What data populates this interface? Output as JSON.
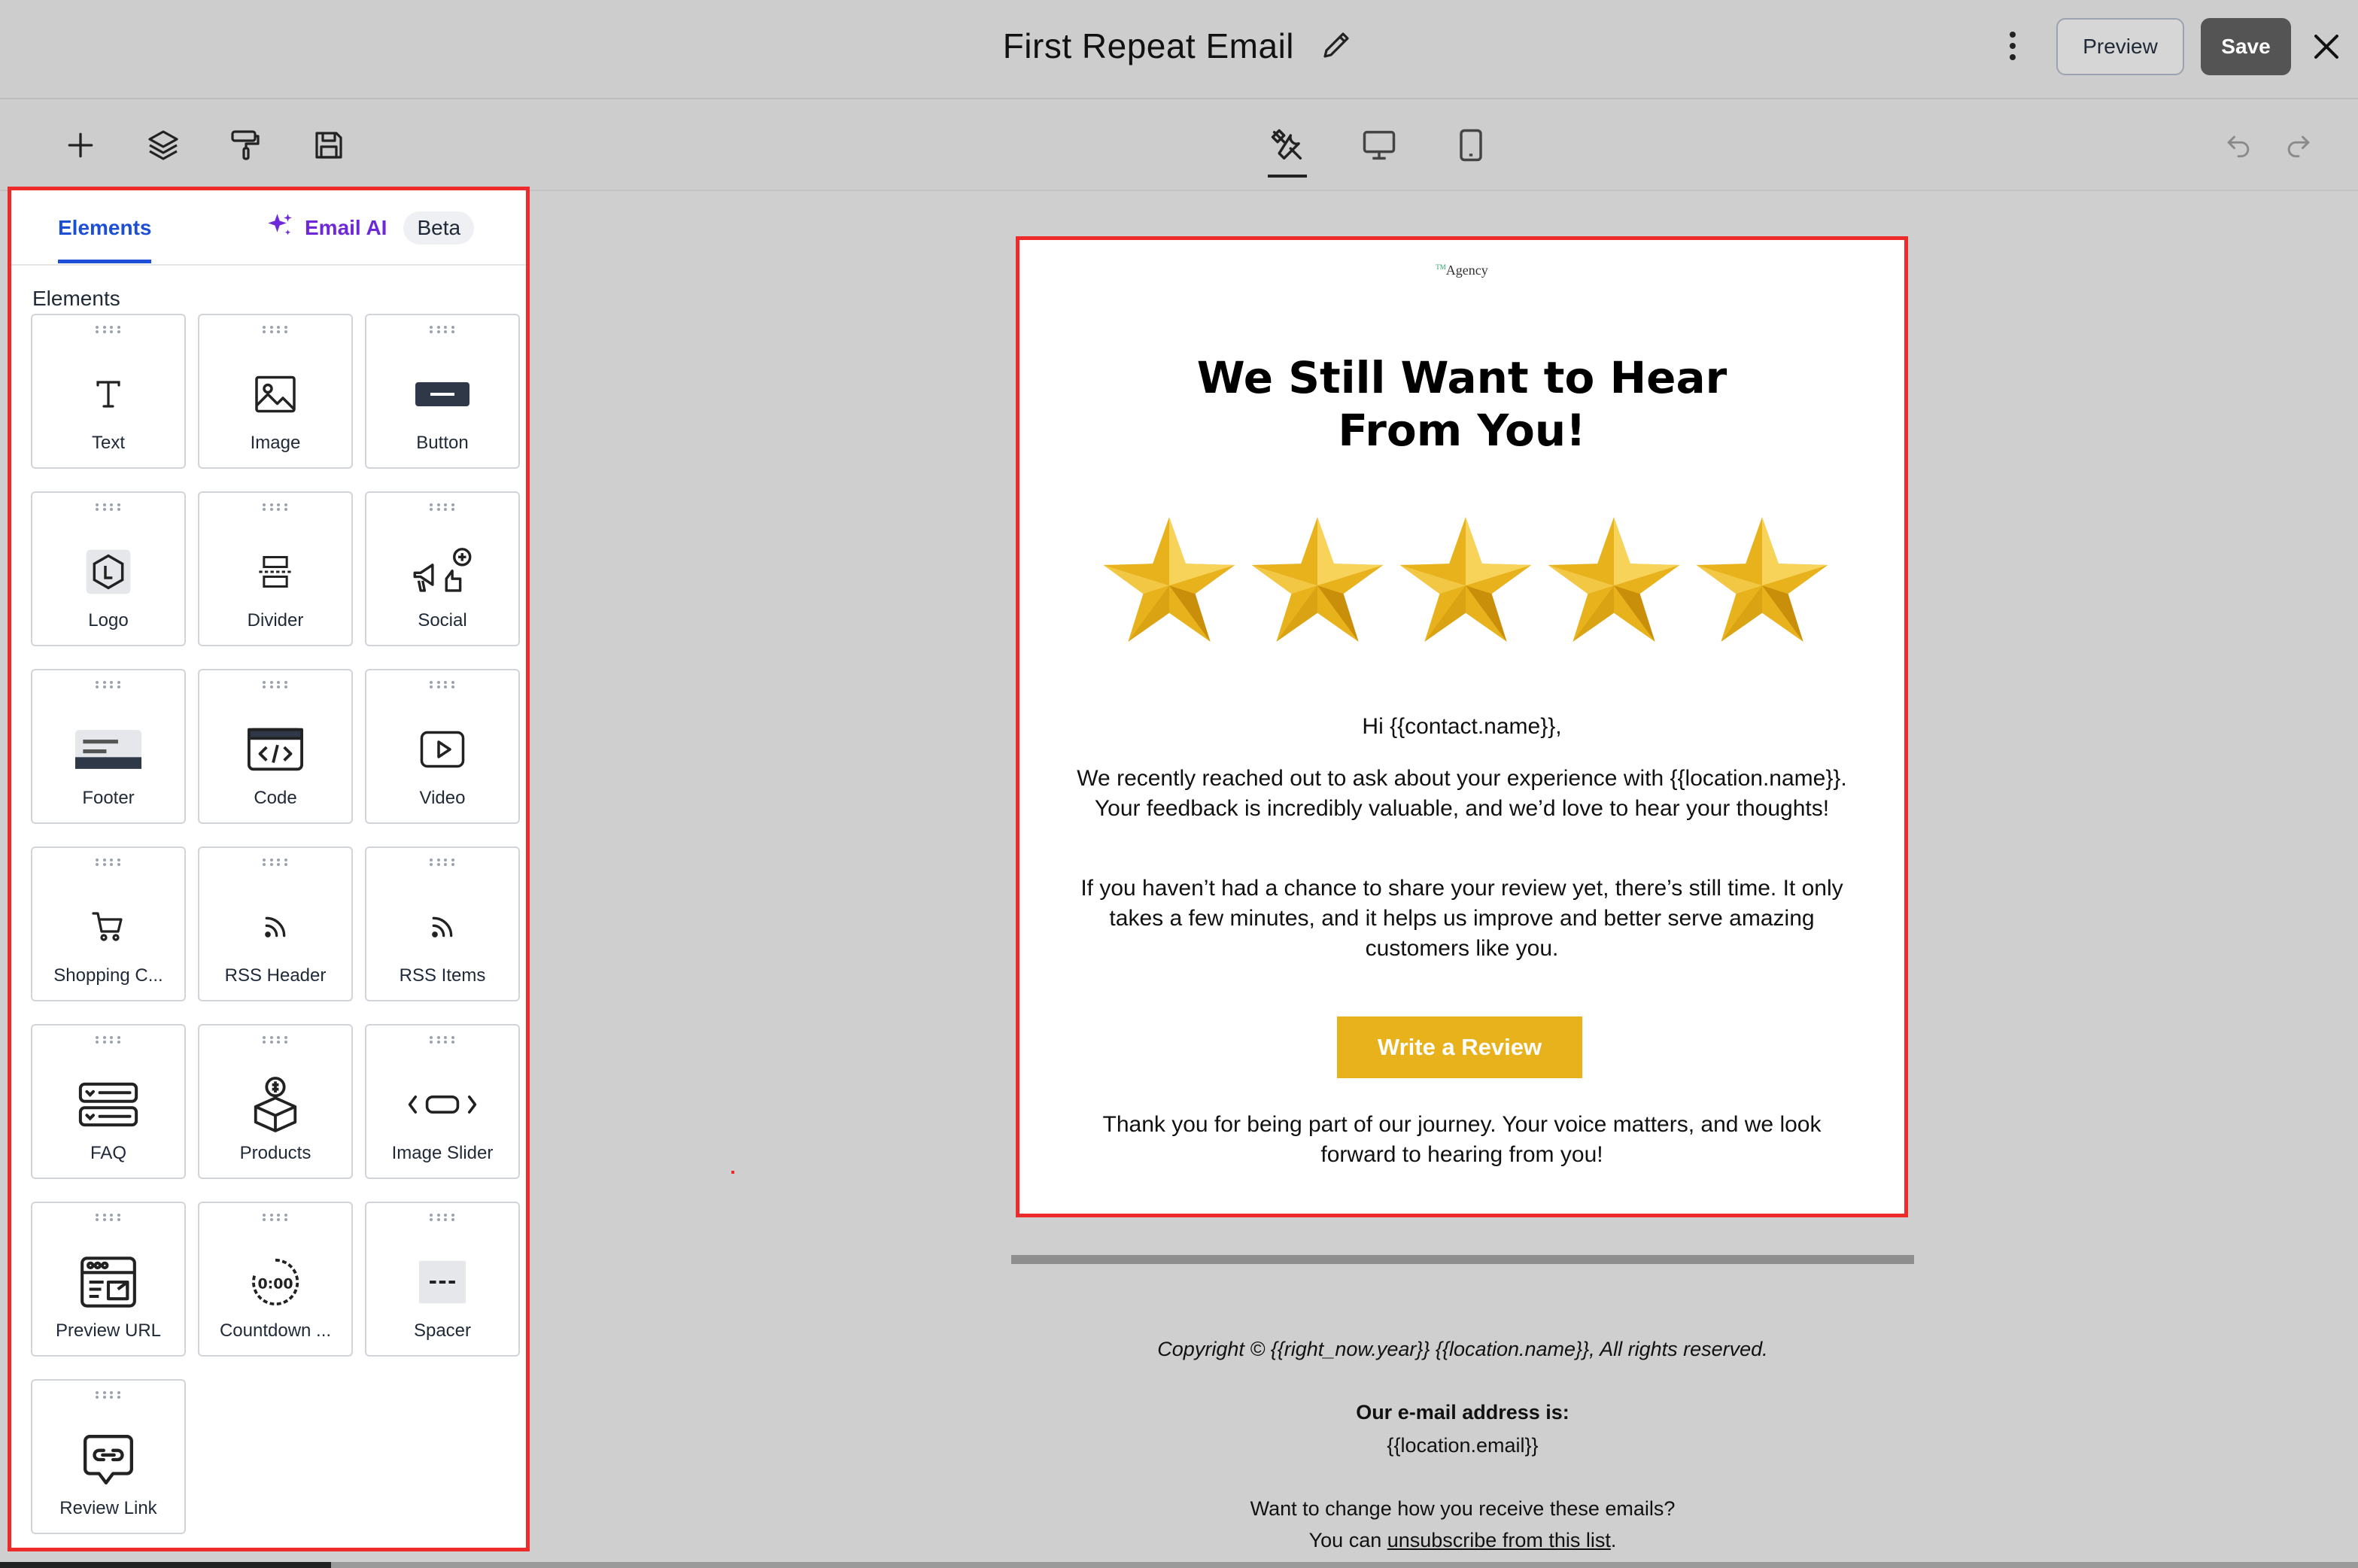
{
  "header": {
    "title": "First Repeat Email",
    "preview_label": "Preview",
    "save_label": "Save"
  },
  "panel": {
    "tab_elements": "Elements",
    "tab_ai": "Email AI",
    "beta": "Beta",
    "section_title": "Elements",
    "items": [
      {
        "label": "Text",
        "icon": "text-icon"
      },
      {
        "label": "Image",
        "icon": "image-icon"
      },
      {
        "label": "Button",
        "icon": "button-icon"
      },
      {
        "label": "Logo",
        "icon": "logo-icon"
      },
      {
        "label": "Divider",
        "icon": "divider-icon"
      },
      {
        "label": "Social",
        "icon": "social-icon"
      },
      {
        "label": "Footer",
        "icon": "footer-icon"
      },
      {
        "label": "Code",
        "icon": "code-icon"
      },
      {
        "label": "Video",
        "icon": "video-icon"
      },
      {
        "label": "Shopping C...",
        "icon": "cart-icon"
      },
      {
        "label": "RSS Header",
        "icon": "rss-icon"
      },
      {
        "label": "RSS Items",
        "icon": "rss-icon"
      },
      {
        "label": "FAQ",
        "icon": "faq-icon"
      },
      {
        "label": "Products",
        "icon": "products-icon"
      },
      {
        "label": "Image Slider",
        "icon": "slider-icon"
      },
      {
        "label": "Preview URL",
        "icon": "preview-url-icon"
      },
      {
        "label": "Countdown ...",
        "icon": "countdown-icon"
      },
      {
        "label": "Spacer",
        "icon": "spacer-icon"
      },
      {
        "label": "Review Link",
        "icon": "review-link-icon"
      }
    ]
  },
  "email": {
    "logo": "Agency",
    "headline_line1": "We Still Want to Hear",
    "headline_line2": "From You!",
    "greeting": "Hi {{contact.name}},",
    "para1": "We recently reached out to ask about your experience with {{location.name}}. Your feedback is incredibly valuable, and we’d love to hear your thoughts!",
    "para2": "If you haven’t had a chance to share your review yet, there’s still time. It only takes a few minutes, and it helps us improve and better serve amazing customers like you.",
    "cta": "Write a Review",
    "para3": "Thank you for being part of our journey. Your voice matters, and we look forward to hearing from you!",
    "star_color": "#e8b21c"
  },
  "footer": {
    "copyright": "Copyright © {{right_now.year}}  {{location.name}}, All rights reserved.",
    "address_label": "Our e-mail address is:",
    "address_value": "{{location.email}}",
    "change_text": "Want to change how you receive these emails?",
    "unsubscribe_prefix": "You can ",
    "unsubscribe_link": "unsubscribe from this list",
    "unsubscribe_suffix": "."
  },
  "colors": {
    "highlight": "#ee2b2b",
    "primary_blue": "#1d4ed8",
    "ai_purple": "#6d28d9",
    "cta_yellow": "#e8b21c"
  }
}
